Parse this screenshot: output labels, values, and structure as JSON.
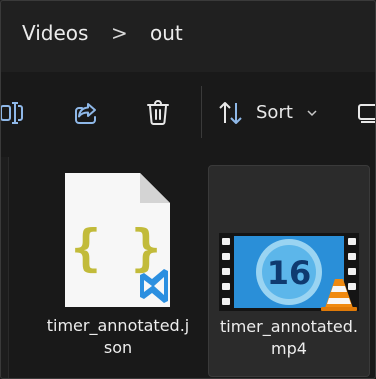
{
  "breadcrumb": {
    "items": [
      "Videos",
      "out"
    ],
    "separator": ">"
  },
  "toolbar": {
    "rename_icon": "rename-icon",
    "share_icon": "share-icon",
    "delete_icon": "trash-icon",
    "sort_label": "Sort",
    "sort_icon": "sort-arrows-icon",
    "sort_dropdown_icon": "chevron-down-icon",
    "view_icon": "view-icon"
  },
  "files": [
    {
      "name_line1": "timer_annotated.j",
      "name_line2": "son",
      "icon": "json-file-icon",
      "badge_icon": "vscode-icon",
      "selected": false
    },
    {
      "name_line1": "timer_annotated.",
      "name_line2": "mp4",
      "thumbnail_text": "16",
      "icon": "video-file-icon",
      "badge_icon": "vlc-cone-icon",
      "selected": true
    }
  ],
  "colors": {
    "background": "#191919",
    "json_braces": "#c8c040",
    "vscode_blue": "#2b8fe0",
    "video_blue": "#2a8fd8",
    "vlc_orange": "#f08a10"
  }
}
